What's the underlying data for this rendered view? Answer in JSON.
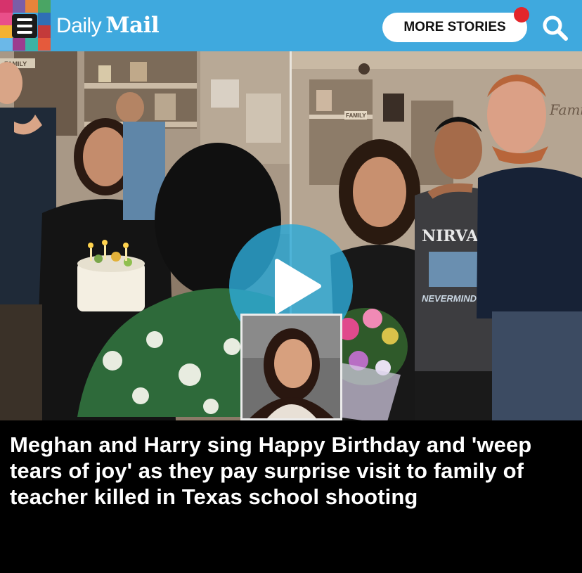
{
  "header": {
    "brand_daily": "Daily",
    "brand_mail": "Mail",
    "more_stories_label": "MORE STORIES",
    "accent_color": "#3fa9de",
    "notification_color": "#e3262b",
    "menu_icon": "hamburger-icon",
    "search_icon": "search-icon"
  },
  "media": {
    "type": "video",
    "play_icon": "play-icon",
    "shirt_text": "NIRVANA",
    "shirt_subtext": "NEVERMIND",
    "sign_text": "FAMILY",
    "wall_sign_text": "Family"
  },
  "headline": {
    "text": "Meghan and Harry sing Happy Birthday and 'weep tears of joy' as they pay surprise visit to family of teacher killed in Texas school shooting"
  }
}
